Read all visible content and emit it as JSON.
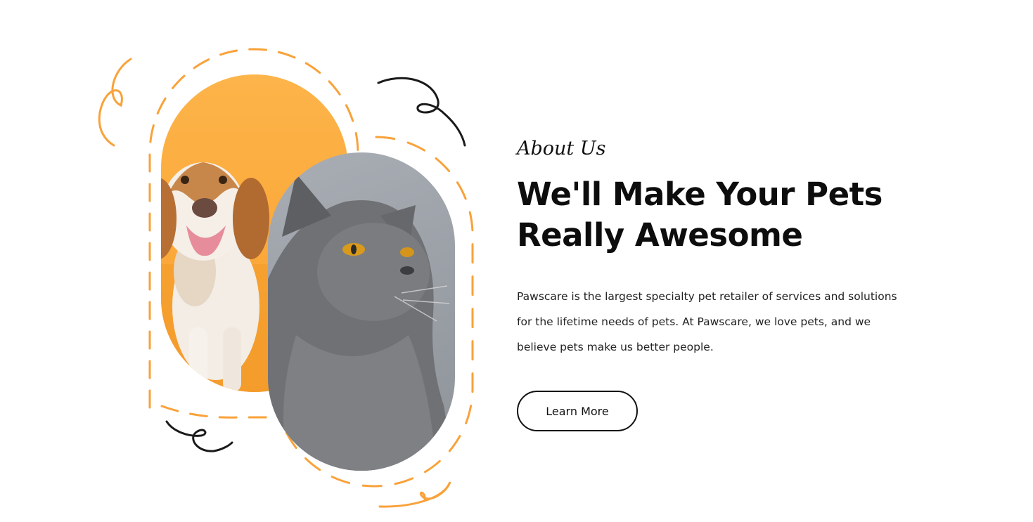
{
  "about": {
    "eyebrow": "About Us",
    "title_line1": "We'll Make Your Pets",
    "title_line2": "Really Awesome",
    "description": "Pawscare is the largest specialty pet retailer of services and solutions for the lifetime needs of pets. At Pawscare, we love pets, and we believe pets make us better people.",
    "button_label": "Learn More"
  },
  "colors": {
    "accent": "#f9a23a",
    "text": "#0d0d0d",
    "scribble": "#1a1a1a"
  },
  "images": {
    "dog": "beagle-dog-photo",
    "cat": "gray-british-shorthair-cat-photo"
  }
}
